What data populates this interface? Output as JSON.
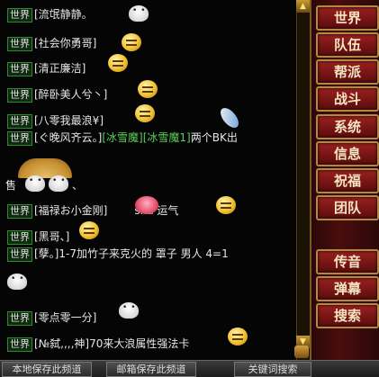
{
  "channel_tag": "世界",
  "chat": [
    {
      "name": "[流氓静静。",
      "msg": ""
    },
    {
      "name": "[社会你勇哥]",
      "msg": ""
    },
    {
      "name": "[清正廉洁]",
      "msg": ""
    },
    {
      "name": "[醉卧美人兮丶]",
      "msg": ""
    },
    {
      "name": "[八零我最浪¥]",
      "msg": ""
    },
    {
      "name": "[ぐ晚风齐云。]",
      "links": "[冰雪魔][冰雪魔1]",
      "msg": "两个BK出"
    },
    {
      "name": "",
      "msg": "售"
    },
    {
      "name": "",
      "msg": "、"
    },
    {
      "name": "[福禄お小金刚]",
      "msg": "sha 运气"
    },
    {
      "name": "[黑哥、]",
      "msg": ""
    },
    {
      "name": "[孽。]",
      "msg": "1-7加竹子来克火的 罩子 男人 4=1"
    },
    {
      "name": "[零点零一分]",
      "msg": ""
    },
    {
      "name": "[№弑,,,,神]",
      "msg": "70来大浪属性强法卡"
    }
  ],
  "side_buttons": [
    "世界",
    "队伍",
    "帮派",
    "战斗",
    "系统",
    "信息",
    "祝福",
    "团队",
    "传音",
    "弹幕",
    "搜索"
  ],
  "bottom_buttons": [
    "本地保存此频道",
    "邮箱保存此频道",
    "关键词搜索"
  ],
  "icons": [
    "scroll-up-arrow",
    "scroll-down-arrow",
    "emoji-face",
    "ghost-face",
    "umbrella",
    "feather",
    "crab"
  ]
}
